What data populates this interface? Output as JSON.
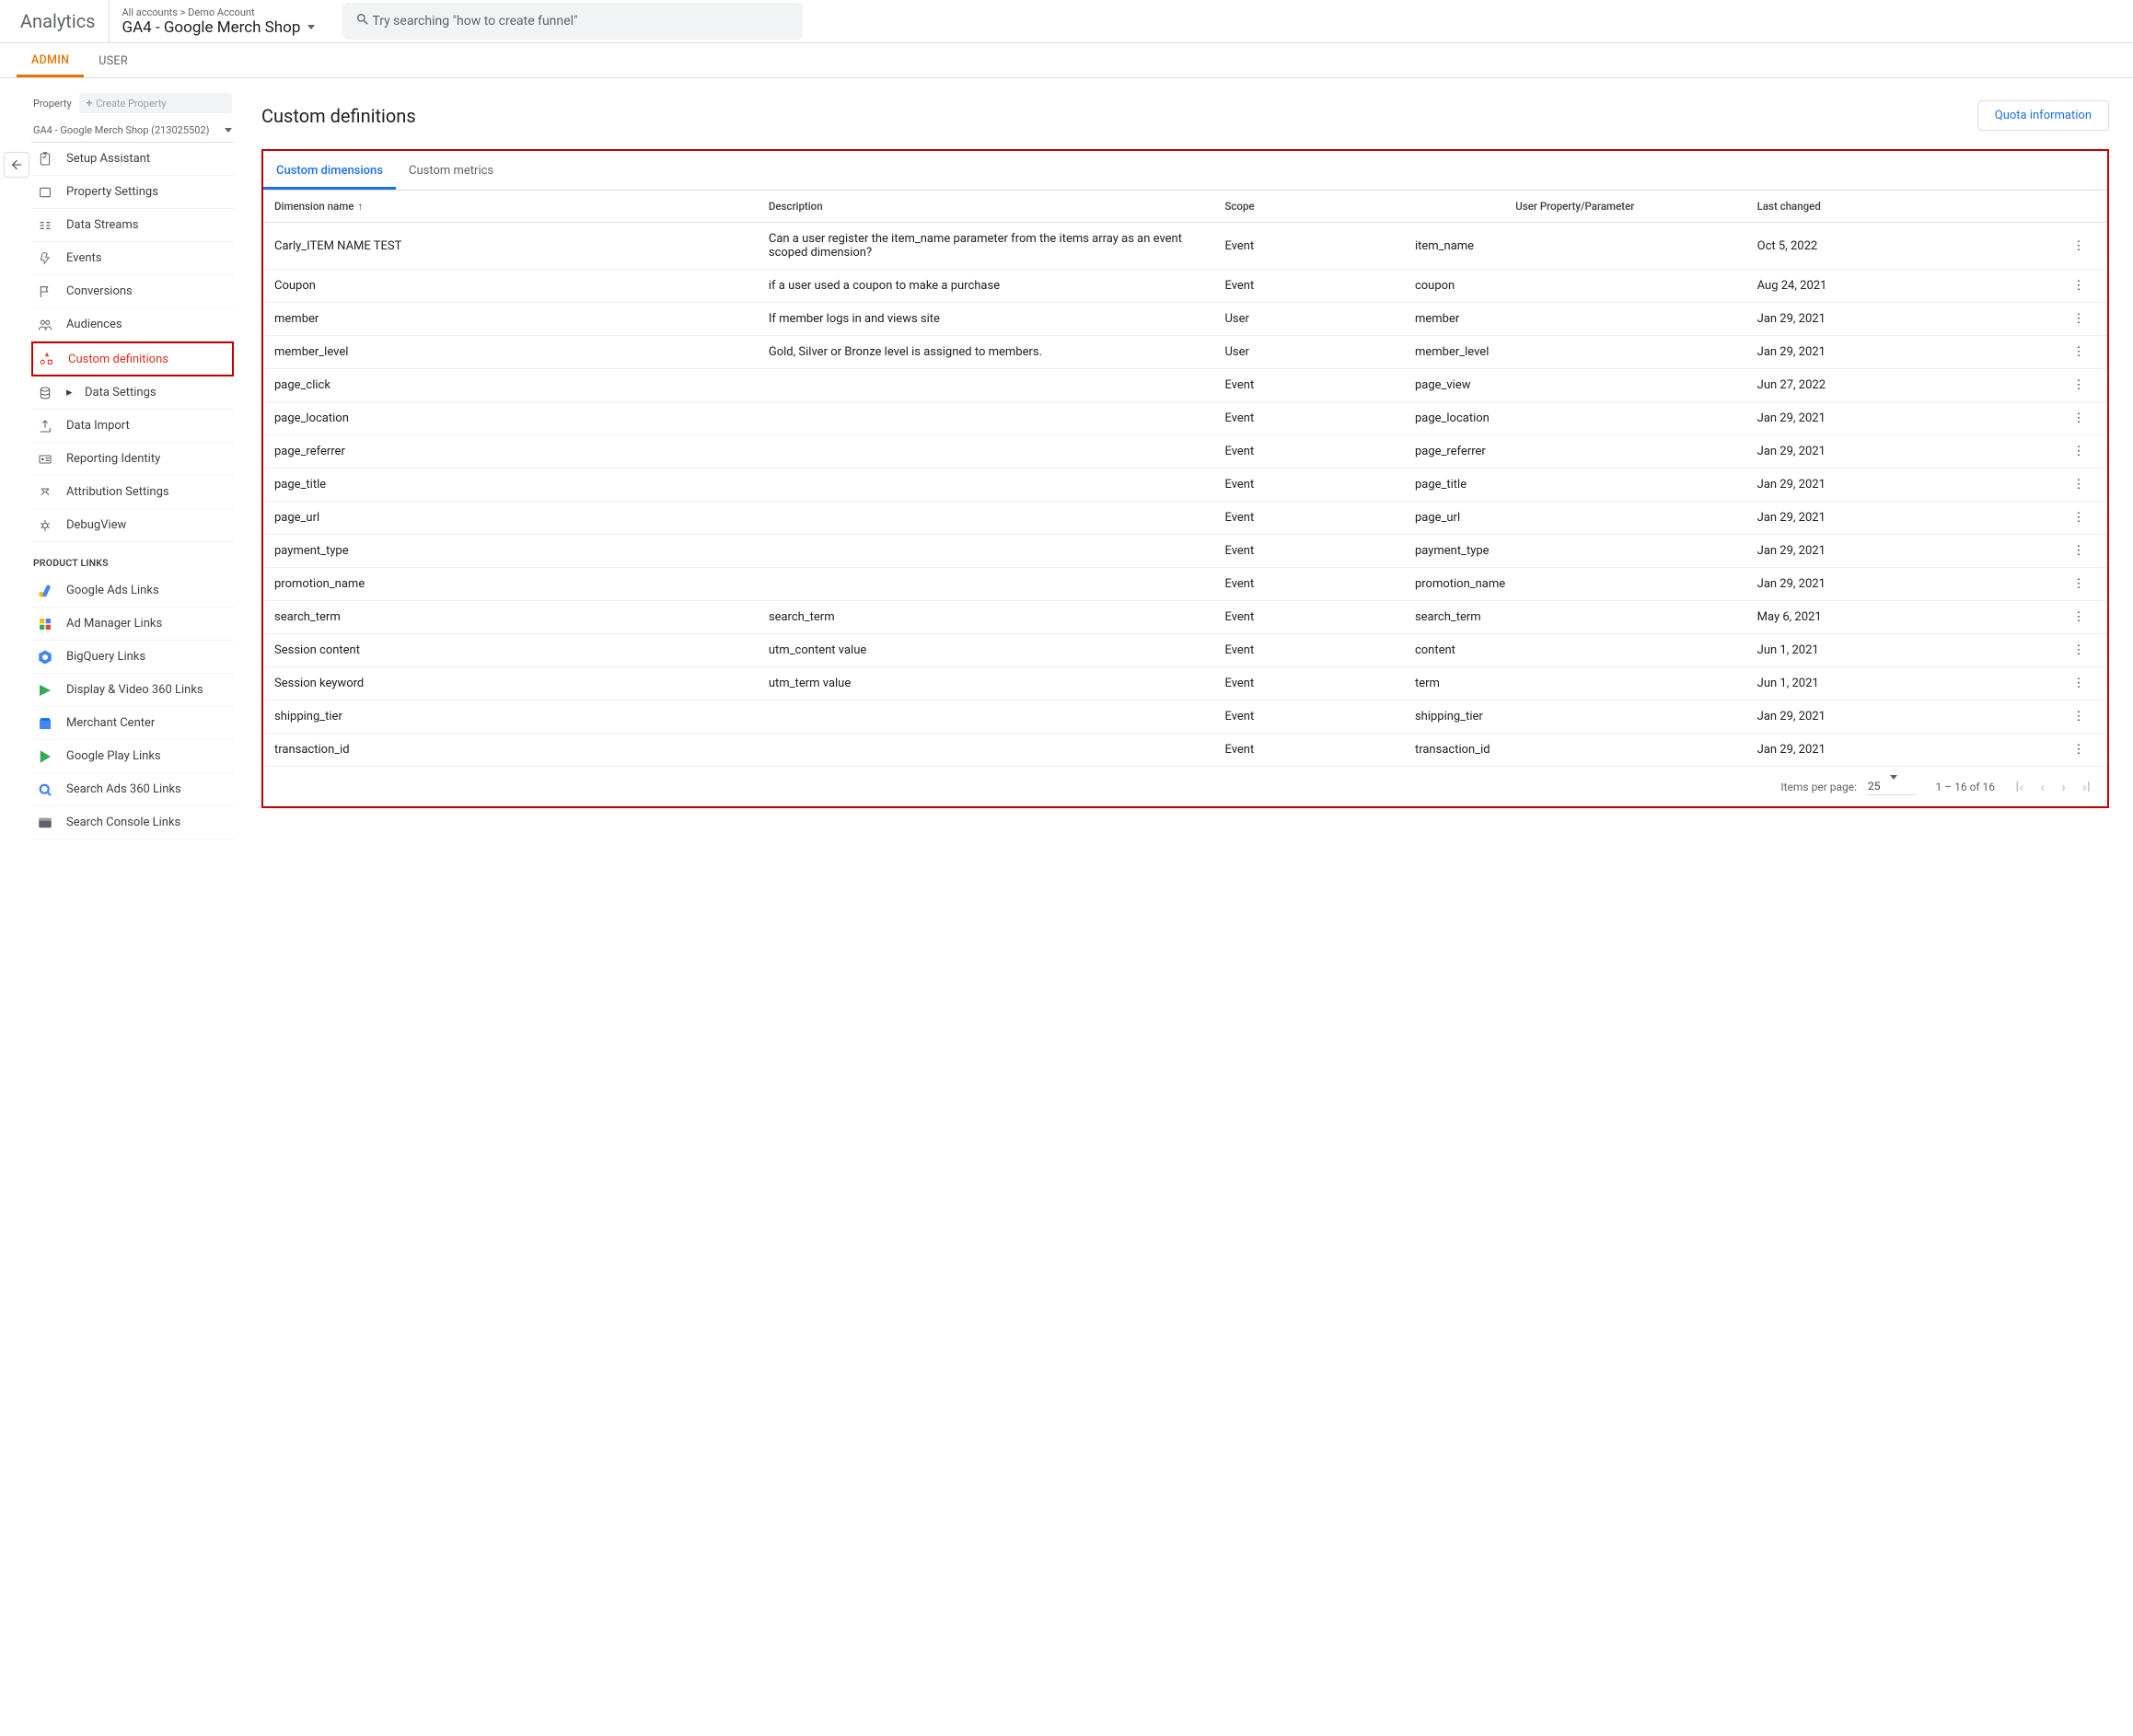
{
  "brand": "Analytics",
  "breadcrumb_top": "All accounts > Demo Account",
  "breadcrumb_main": "GA4 - Google Merch Shop",
  "search_placeholder": "Try searching \"how to create funnel\"",
  "top_tabs": {
    "admin": "ADMIN",
    "user": "USER"
  },
  "property_section": {
    "label": "Property",
    "create_button": "Create Property",
    "selected": "GA4 - Google Merch Shop (213025502)"
  },
  "sidebar": {
    "items": [
      {
        "label": "Setup Assistant",
        "icon": "clipboard"
      },
      {
        "label": "Property Settings",
        "icon": "rect"
      },
      {
        "label": "Data Streams",
        "icon": "streams"
      },
      {
        "label": "Events",
        "icon": "event"
      },
      {
        "label": "Conversions",
        "icon": "flag"
      },
      {
        "label": "Audiences",
        "icon": "audience"
      },
      {
        "label": "Custom definitions",
        "icon": "custom",
        "active": true
      },
      {
        "label": "Data Settings",
        "icon": "db",
        "expand": true
      },
      {
        "label": "Data Import",
        "icon": "upload"
      },
      {
        "label": "Reporting Identity",
        "icon": "identity"
      },
      {
        "label": "Attribution Settings",
        "icon": "attrib"
      },
      {
        "label": "DebugView",
        "icon": "debug"
      }
    ],
    "product_links_label": "PRODUCT LINKS",
    "product_links": [
      {
        "label": "Google Ads Links",
        "icon": "ads"
      },
      {
        "label": "Ad Manager Links",
        "icon": "admgr"
      },
      {
        "label": "BigQuery Links",
        "icon": "bq"
      },
      {
        "label": "Display & Video 360 Links",
        "icon": "dv360"
      },
      {
        "label": "Merchant Center",
        "icon": "merchant"
      },
      {
        "label": "Google Play Links",
        "icon": "play"
      },
      {
        "label": "Search Ads 360 Links",
        "icon": "sa360"
      },
      {
        "label": "Search Console Links",
        "icon": "search-console"
      }
    ]
  },
  "page": {
    "title": "Custom definitions",
    "quota_button": "Quota information",
    "tabs": {
      "dimensions": "Custom dimensions",
      "metrics": "Custom metrics"
    },
    "columns": {
      "name": "Dimension name",
      "desc": "Description",
      "scope": "Scope",
      "param": "User Property/Parameter",
      "changed": "Last changed"
    },
    "rows": [
      {
        "name": "Carly_ITEM NAME TEST",
        "desc": "Can a user register the item_name parameter from the items array as an event scoped dimension?",
        "scope": "Event",
        "param": "item_name",
        "changed": "Oct 5, 2022"
      },
      {
        "name": "Coupon",
        "desc": "if a user used a coupon to make a purchase",
        "scope": "Event",
        "param": "coupon",
        "changed": "Aug 24, 2021"
      },
      {
        "name": "member",
        "desc": "If member logs in and views site",
        "scope": "User",
        "param": "member",
        "changed": "Jan 29, 2021"
      },
      {
        "name": "member_level",
        "desc": "Gold, Silver or Bronze level is assigned to members.",
        "scope": "User",
        "param": "member_level",
        "changed": "Jan 29, 2021"
      },
      {
        "name": "page_click",
        "desc": "",
        "scope": "Event",
        "param": "page_view",
        "changed": "Jun 27, 2022"
      },
      {
        "name": "page_location",
        "desc": "",
        "scope": "Event",
        "param": "page_location",
        "changed": "Jan 29, 2021"
      },
      {
        "name": "page_referrer",
        "desc": "",
        "scope": "Event",
        "param": "page_referrer",
        "changed": "Jan 29, 2021"
      },
      {
        "name": "page_title",
        "desc": "",
        "scope": "Event",
        "param": "page_title",
        "changed": "Jan 29, 2021"
      },
      {
        "name": "page_url",
        "desc": "",
        "scope": "Event",
        "param": "page_url",
        "changed": "Jan 29, 2021"
      },
      {
        "name": "payment_type",
        "desc": "",
        "scope": "Event",
        "param": "payment_type",
        "changed": "Jan 29, 2021"
      },
      {
        "name": "promotion_name",
        "desc": "",
        "scope": "Event",
        "param": "promotion_name",
        "changed": "Jan 29, 2021"
      },
      {
        "name": "search_term",
        "desc": "search_term",
        "scope": "Event",
        "param": "search_term",
        "changed": "May 6, 2021"
      },
      {
        "name": "Session content",
        "desc": "utm_content value",
        "scope": "Event",
        "param": "content",
        "changed": "Jun 1, 2021"
      },
      {
        "name": "Session keyword",
        "desc": "utm_term value",
        "scope": "Event",
        "param": "term",
        "changed": "Jun 1, 2021"
      },
      {
        "name": "shipping_tier",
        "desc": "",
        "scope": "Event",
        "param": "shipping_tier",
        "changed": "Jan 29, 2021"
      },
      {
        "name": "transaction_id",
        "desc": "",
        "scope": "Event",
        "param": "transaction_id",
        "changed": "Jan 29, 2021"
      }
    ],
    "pager": {
      "items_per_page_label": "Items per page:",
      "items_per_page_value": "25",
      "range": "1 – 16 of 16"
    }
  }
}
